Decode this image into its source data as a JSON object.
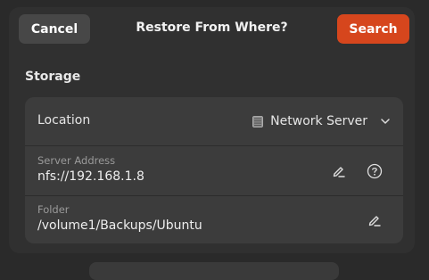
{
  "dialog": {
    "title": "Restore From Where?",
    "cancel_label": "Cancel",
    "search_label": "Search"
  },
  "storage": {
    "section_title": "Storage",
    "location": {
      "label": "Location",
      "value": "Network Server",
      "icon": "server-icon"
    },
    "server_address": {
      "label": "Server Address",
      "value": "nfs://192.168.1.8",
      "edit_icon": "edit-icon",
      "help_icon": "help-icon"
    },
    "folder": {
      "label": "Folder",
      "value": "/volume1/Backups/Ubuntu",
      "edit_icon": "edit-icon"
    }
  },
  "colors": {
    "accent": "#d6461d",
    "dialog_bg": "#303030",
    "card_bg": "#3c3c3c"
  }
}
